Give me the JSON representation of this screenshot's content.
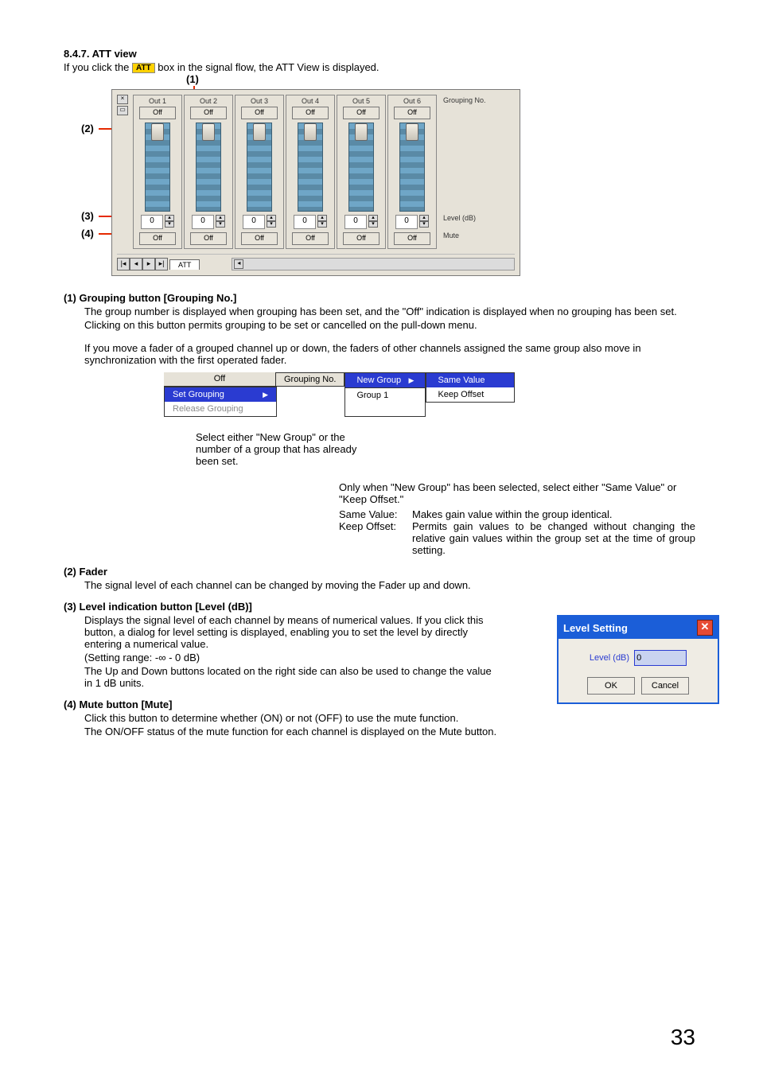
{
  "page_number": "33",
  "heading": "8.4.7. ATT view",
  "intro_prefix": "If you click the ",
  "att_chip": "ATT",
  "intro_suffix": " box in the signal flow, the ATT View is displayed.",
  "callouts": {
    "c1": "(1)",
    "c2": "(2)",
    "c3": "(3)",
    "c4": "(4)"
  },
  "channels": [
    "Out 1",
    "Out 2",
    "Out 3",
    "Out 4",
    "Out 5",
    "Out 6"
  ],
  "grp_off": "Off",
  "level_val": "0",
  "mute_off": "Off",
  "side": {
    "grouping": "Grouping No.",
    "level": "Level (dB)",
    "mute": "Mute"
  },
  "tab": "ATT",
  "sec1": {
    "title": "(1) Grouping button [Grouping No.]",
    "p1": "The group number is displayed when grouping has been set, and the \"Off\" indication is displayed when no grouping has been set.",
    "p2": "Clicking on this button permits grouping to be set or cancelled on the pull-down menu.",
    "p3": "If you move a fader of a grouped channel up or down, the faders of other channels assigned the same group also move in synchronization with the first operated fader."
  },
  "menu": {
    "off": "Off",
    "grouping_no": "Grouping No.",
    "set": "Set Grouping",
    "release": "Release Grouping",
    "new_group": "New Group",
    "group1": "Group 1",
    "same_value": "Same Value",
    "keep_offset": "Keep Offset"
  },
  "note": "Select either \"New Group\" or the number of a group that has already been set.",
  "newgroup_note": "Only when \"New Group\" has been selected, select either \"Same Value\" or \"Keep Offset.\"",
  "defs": {
    "same_label": "Same Value:",
    "same_text": "Makes gain value within the group identical.",
    "keep_label": "Keep Offset:",
    "keep_text": "Permits gain values to be changed without changing the relative gain values within the group set at the time of group setting."
  },
  "sec2": {
    "title": "(2) Fader",
    "p1": "The signal level of each channel can be changed by moving the Fader up and down."
  },
  "sec3": {
    "title": "(3) Level indication button [Level (dB)]",
    "p1": "Displays the signal level of each channel by means of numerical values. If you click this button, a dialog for level setting is displayed, enabling you to set the level by directly entering a numerical value.",
    "p2": "(Setting range: -∞ - 0 dB)",
    "p3": "The Up and Down buttons located on the right side can also be used to change the value in 1 dB units."
  },
  "sec4": {
    "title": "(4) Mute button [Mute]",
    "p1": "Click this button to determine whether (ON) or not (OFF) to use the mute function.",
    "p2": "The ON/OFF status of the mute function for each channel is displayed on the Mute button."
  },
  "dialog": {
    "title": "Level Setting",
    "label": "Level (dB)",
    "value": "0",
    "ok": "OK",
    "cancel": "Cancel"
  }
}
